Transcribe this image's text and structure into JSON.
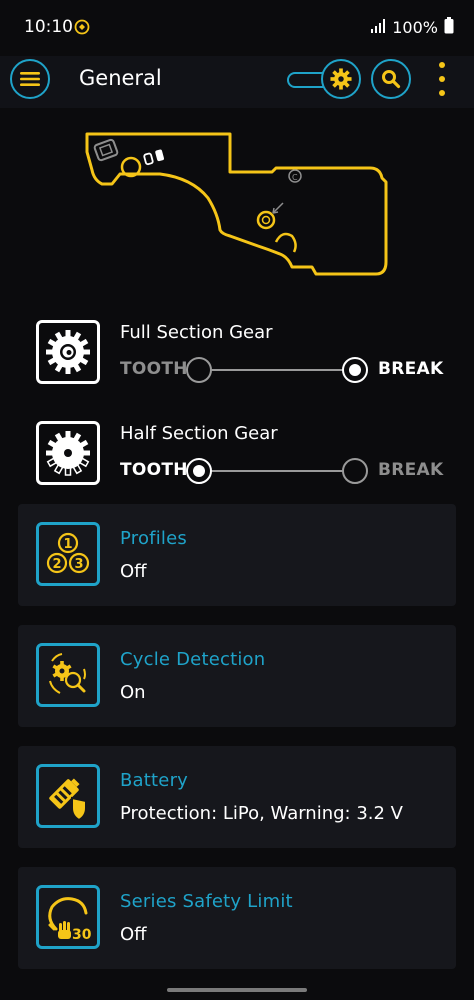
{
  "status_bar": {
    "time": "10:10",
    "battery": "100%"
  },
  "app_bar": {
    "title": "General"
  },
  "gears": [
    {
      "title": "Full Section Gear",
      "left": "TOOTH",
      "right": "BREAK",
      "selected": "BREAK"
    },
    {
      "title": "Half Section Gear",
      "left": "TOOTH",
      "right": "BREAK",
      "selected": "TOOTH"
    }
  ],
  "cards": [
    {
      "title": "Profiles",
      "value": "Off",
      "icon": "profiles-icon"
    },
    {
      "title": "Cycle Detection",
      "value": "On",
      "icon": "cycle-detection-icon"
    },
    {
      "title": "Battery",
      "value": "Protection: LiPo, Warning: 3.2 V",
      "icon": "battery-icon"
    },
    {
      "title": "Series Safety Limit",
      "value": "Off",
      "icon": "safety-limit-icon"
    }
  ],
  "icons": {
    "profile_numbers": [
      "1",
      "2",
      "3"
    ],
    "safety_limit_number": "30"
  },
  "colors": {
    "accent": "#1fa3c9",
    "yellow": "#f5c518",
    "card_bg": "#16171c",
    "background": "#0b0b0d"
  }
}
